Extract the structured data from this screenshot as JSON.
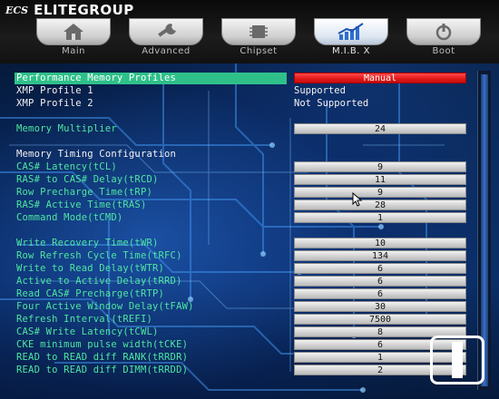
{
  "brand": {
    "mark": "ECS",
    "name": "ELITEGROUP"
  },
  "tabs": [
    {
      "label": "Main",
      "icon": "house-icon",
      "active": false
    },
    {
      "label": "Advanced",
      "icon": "wrench-icon",
      "active": false
    },
    {
      "label": "Chipset",
      "icon": "chip-icon",
      "active": false
    },
    {
      "label": "M.I.B. X",
      "icon": "graph-icon",
      "active": true
    },
    {
      "label": "Boot",
      "icon": "power-icon",
      "active": false
    }
  ],
  "settings": {
    "perf_profiles": {
      "label": "Performance Memory Profiles",
      "value": "Manual"
    },
    "xmp1": {
      "label": "XMP Profile 1",
      "value": "Supported"
    },
    "xmp2": {
      "label": "XMP Profile 2",
      "value": "Not Supported"
    },
    "multiplier": {
      "label": "Memory Multiplier",
      "value": "24"
    },
    "timing_header": "Memory Timing Configuration",
    "timings": [
      {
        "label": "CAS# Latency(tCL)",
        "value": "9"
      },
      {
        "label": "RAS# to CAS# Delay(tRCD)",
        "value": "11"
      },
      {
        "label": "Row Precharge Time(tRP)",
        "value": "9"
      },
      {
        "label": "RAS# Active Time(tRAS)",
        "value": "28"
      },
      {
        "label": "Command Mode(tCMD)",
        "value": "1"
      }
    ],
    "advanced_timings": [
      {
        "label": "Write Recovery Time(tWR)",
        "value": "10"
      },
      {
        "label": "Row Refresh Cycle Time(tRFC)",
        "value": "134"
      },
      {
        "label": "Write to Read Delay(tWTR)",
        "value": "6"
      },
      {
        "label": "Active to Active Delay(tRRD)",
        "value": "6"
      },
      {
        "label": "Read CAS# Precharge(tRTP)",
        "value": "6"
      },
      {
        "label": "Four Active Window Delay(tFAW)",
        "value": "30"
      },
      {
        "label": "Refresh Interval(tREFI)",
        "value": "7500"
      },
      {
        "label": "CAS# Write Latency(tCWL)",
        "value": "8"
      },
      {
        "label": "CKE minimum pulse width(tCKE)",
        "value": "6"
      },
      {
        "label": "READ to READ diff RANK(tRRDR)",
        "value": "1"
      },
      {
        "label": "READ to READ diff DIMM(tRRDD)",
        "value": "2"
      }
    ]
  },
  "colors": {
    "highlight": "#2fc08a",
    "label_green": "#4ee6a0",
    "manual_red": "#e01818"
  }
}
